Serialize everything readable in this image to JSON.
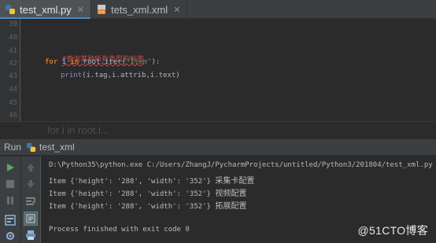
{
  "tabs": [
    {
      "label": "test_xml.py",
      "active": true
    },
    {
      "label": "tets_xml.xml",
      "active": false
    }
  ],
  "editor": {
    "line_numbers": [
      "39",
      "40",
      "41",
      "42",
      "43",
      "44",
      "45",
      "46"
    ],
    "comment": "#查询某种所有类型的标签",
    "for_kw": "for",
    "for_var": " i ",
    "in_kw": "in",
    "for_obj": " root.iter(",
    "for_str": "\"Item\"",
    "for_end": "):",
    "print_fn": "print",
    "print_args": "(i.tag,i.attrib,i.text)"
  },
  "breadcrumb_ghost": "for i in root.i...",
  "run": {
    "label": "Run",
    "config": "test_xml",
    "command": "D:\\Python35\\python.exe C:/Users/ZhangJ/PycharmProjects/untitled/Python3/201804/test_xml.py",
    "output": [
      {
        "prefix": "Item {'height': '288', 'width': '352'} ",
        "cjk": "采集卡配置"
      },
      {
        "prefix": "Item {'height': '288', 'width': '352'} ",
        "cjk": "视频配置"
      },
      {
        "prefix": "Item {'height': '288', 'width': '352'} ",
        "cjk": "拓展配置"
      }
    ],
    "exit": "Process finished with exit code 0"
  },
  "watermark": "@51CTO博客",
  "colors": {
    "accent": "#4a88c7",
    "run_green": "#59a869",
    "stop_gray": "#6e6e6e"
  }
}
